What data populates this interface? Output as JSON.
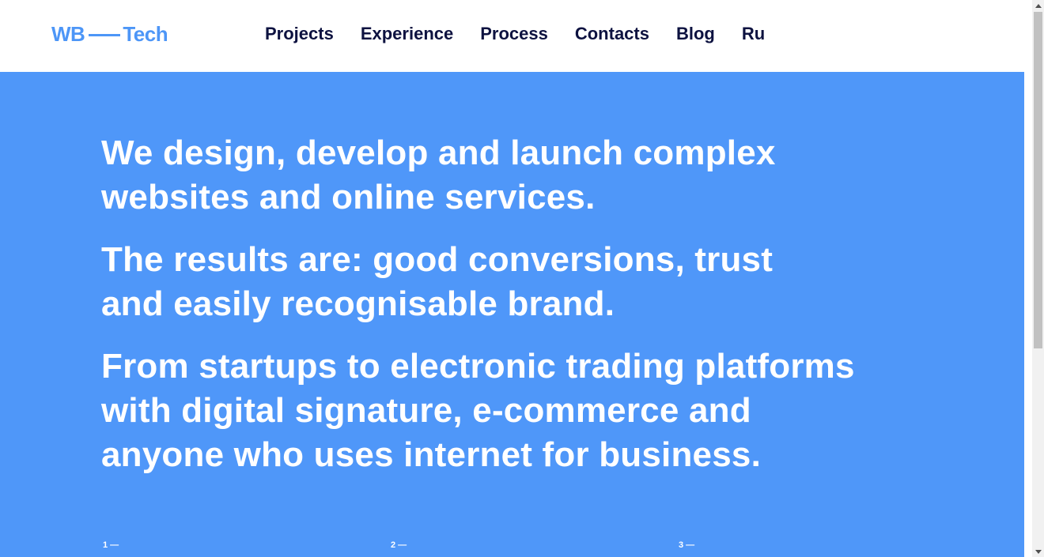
{
  "header": {
    "logo": {
      "left": "WB",
      "right": "Tech"
    },
    "nav": [
      {
        "label": "Projects"
      },
      {
        "label": "Experience"
      },
      {
        "label": "Process"
      },
      {
        "label": "Contacts"
      },
      {
        "label": "Blog"
      },
      {
        "label": "Ru"
      }
    ]
  },
  "hero": {
    "paragraphs": [
      [
        "We design, develop and launch complex",
        "websites and online services."
      ],
      [
        "The results are: good conversions, trust",
        "and easily recognisable brand."
      ],
      [
        "From startups to electronic trading platforms",
        "with digital signature, e-commerce and",
        "anyone who uses internet for business."
      ]
    ],
    "steps": [
      "1 —",
      "2 —",
      "3 —"
    ]
  },
  "colors": {
    "accent": "#4f97f9",
    "logo": "#4d96f7",
    "nav_text": "#0d1240",
    "hero_text": "#ffffff"
  }
}
